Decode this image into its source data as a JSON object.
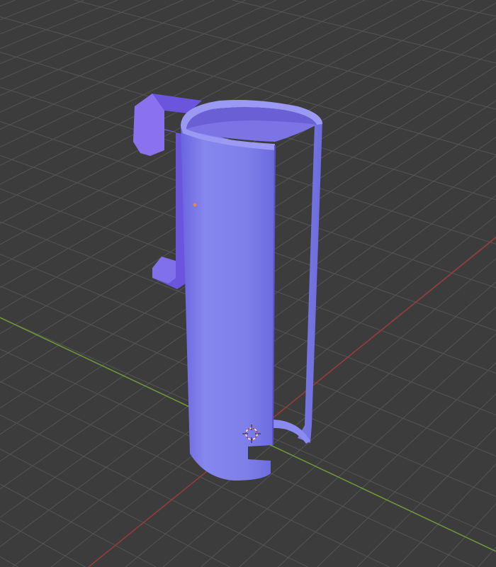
{
  "viewport": {
    "colors": {
      "background": "#3c3c3c",
      "grid": "#545454",
      "x_axis": "#9a3a3a",
      "y_axis": "#6f9a38",
      "object": "#7c7ce8",
      "object_light": "#9494f2",
      "object_dark": "#5c4fd0",
      "origin": "#e08a3a"
    },
    "icons": [
      "3d-cursor-icon",
      "object-origin-icon"
    ]
  }
}
